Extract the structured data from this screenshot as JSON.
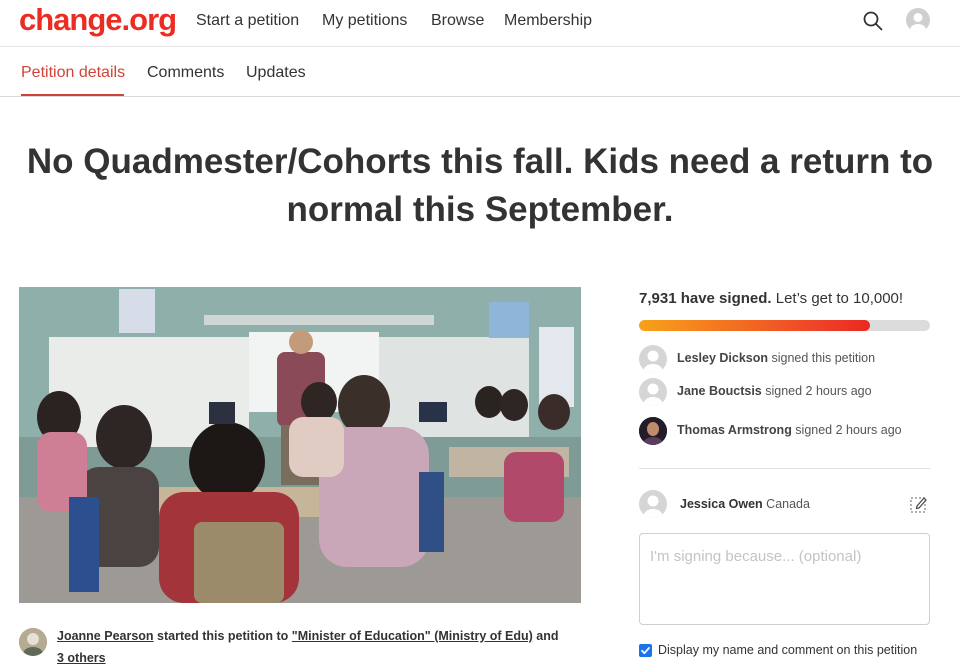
{
  "brand": {
    "logo_text": "change.org",
    "accent": "#ec2c22"
  },
  "nav": {
    "items": [
      {
        "label": "Start a petition"
      },
      {
        "label": "My petitions"
      },
      {
        "label": "Browse"
      },
      {
        "label": "Membership"
      }
    ],
    "search_icon": "search-icon",
    "avatar_icon": "user-avatar-icon"
  },
  "tabs": [
    {
      "label": "Petition details",
      "active": true
    },
    {
      "label": "Comments",
      "active": false
    },
    {
      "label": "Updates",
      "active": false
    }
  ],
  "petition": {
    "title": "No Quadmester/Cohorts this fall. Kids need a return to normal this September.",
    "image_alt": "classroom photo",
    "starter": {
      "name": "Joanne Pearson",
      "started_text": " started this petition to ",
      "target": "\"Minister of Education\" (Ministry of Edu)",
      "and_text": " and ",
      "others": "3 others"
    }
  },
  "signatures": {
    "count_text": "7,931 have signed.",
    "goal_text": " Let’s get to 10,000!",
    "progress_fraction": 0.7931,
    "recent": [
      {
        "name": "Lesley Dickson",
        "action": " signed this petition"
      },
      {
        "name": "Jane Bouctsis",
        "action": " signed 2 hours ago"
      },
      {
        "name": "Thomas Armstrong",
        "action": " signed 2 hours ago"
      }
    ]
  },
  "sign_form": {
    "user_name": "Jessica Owen",
    "user_location": " Canada",
    "comment_placeholder": "I'm signing because... (optional)",
    "display_checkbox_checked": true,
    "display_checkbox_label": "Display my name and comment on this petition"
  }
}
